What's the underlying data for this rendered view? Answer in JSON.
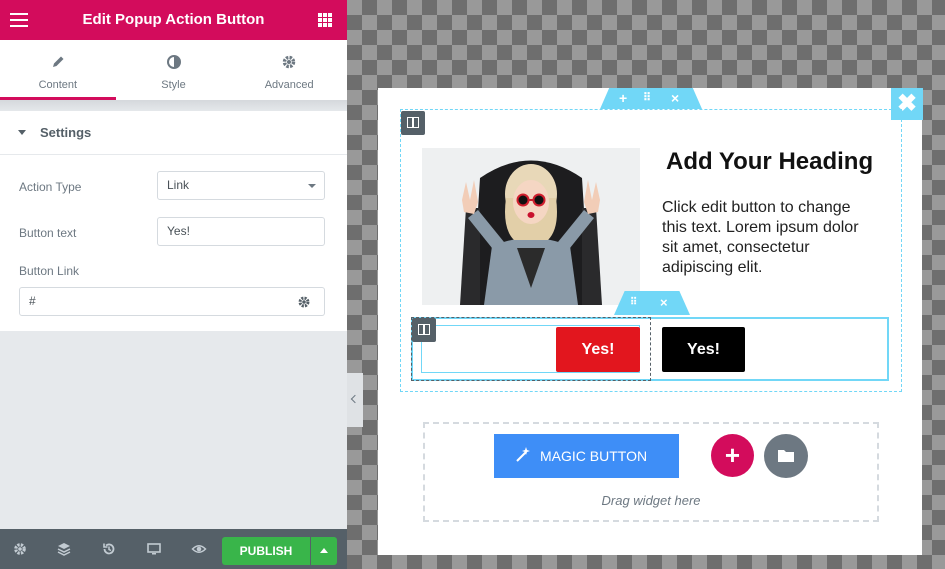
{
  "panel": {
    "title": "Edit Popup Action Button",
    "tabs": [
      {
        "label": "Content",
        "icon": "pencil-icon",
        "active": true
      },
      {
        "label": "Style",
        "icon": "half-circle-icon",
        "active": false
      },
      {
        "label": "Advanced",
        "icon": "gear-icon",
        "active": false
      }
    ],
    "section_title": "Settings",
    "controls": {
      "action_type_label": "Action Type",
      "action_type_value": "Link",
      "button_text_label": "Button text",
      "button_text_value": "Yes!",
      "button_link_label": "Button Link",
      "button_link_value": "#"
    },
    "footer": {
      "publish_label": "PUBLISH",
      "icons": [
        "gear-icon",
        "layers-icon",
        "history-icon",
        "desktop-icon",
        "eye-icon"
      ]
    }
  },
  "canvas": {
    "heading": "Add Your Heading",
    "paragraph": "Click edit button to change this text. Lorem ipsum dolor sit amet, consectetur adipiscing elit.",
    "yes_red": "Yes!",
    "yes_black": "Yes!",
    "magic_button": "MAGIC BUTTON",
    "drag_text": "Drag widget here",
    "handle_plus": "+",
    "handle_close": "×",
    "close_popup": "✖",
    "add_section": "+"
  },
  "colors": {
    "brand": "#d30c5c",
    "accent_blue": "#71d7f7",
    "publish_green": "#39b54a",
    "yes_red": "#e2161e",
    "magic_blue": "#3e8ef7"
  }
}
